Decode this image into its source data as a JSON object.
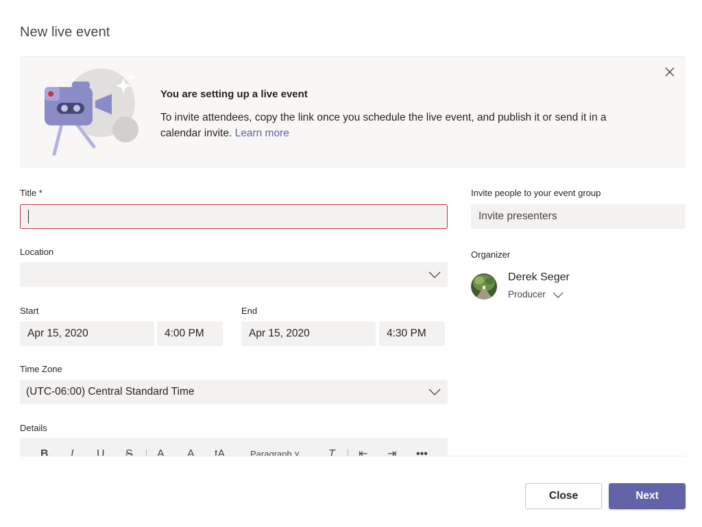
{
  "dialog": {
    "title": "New live event"
  },
  "banner": {
    "heading": "You are setting up a live event",
    "body": "To invite attendees, copy the link once you schedule the live event, and publish it or send it in a calendar invite.",
    "link": "Learn more"
  },
  "form": {
    "title_label": "Title *",
    "title_value": "",
    "location_label": "Location",
    "location_value": "",
    "start_label": "Start",
    "start_date": "Apr 15, 2020",
    "start_time": "4:00 PM",
    "end_label": "End",
    "end_date": "Apr 15, 2020",
    "end_time": "4:30 PM",
    "timezone_label": "Time Zone",
    "timezone_value": "(UTC-06:00) Central Standard Time",
    "details_label": "Details"
  },
  "invite": {
    "label": "Invite people to your event group",
    "placeholder": "Invite presenters"
  },
  "organizer": {
    "label": "Organizer",
    "name": "Derek Seger",
    "role": "Producer"
  },
  "toolbar": {
    "bold": "B",
    "italic": "I",
    "underline": "U",
    "strikethrough": "S",
    "highlight": "A",
    "font_color": "A",
    "font_size": "tA",
    "paragraph": "Paragraph",
    "clear_format": "T",
    "more": "•••"
  },
  "footer": {
    "close_label": "Close",
    "next_label": "Next"
  },
  "colors": {
    "accent": "#6264a7",
    "error_border": "#c4314b",
    "field_bg": "#f3f2f1"
  }
}
